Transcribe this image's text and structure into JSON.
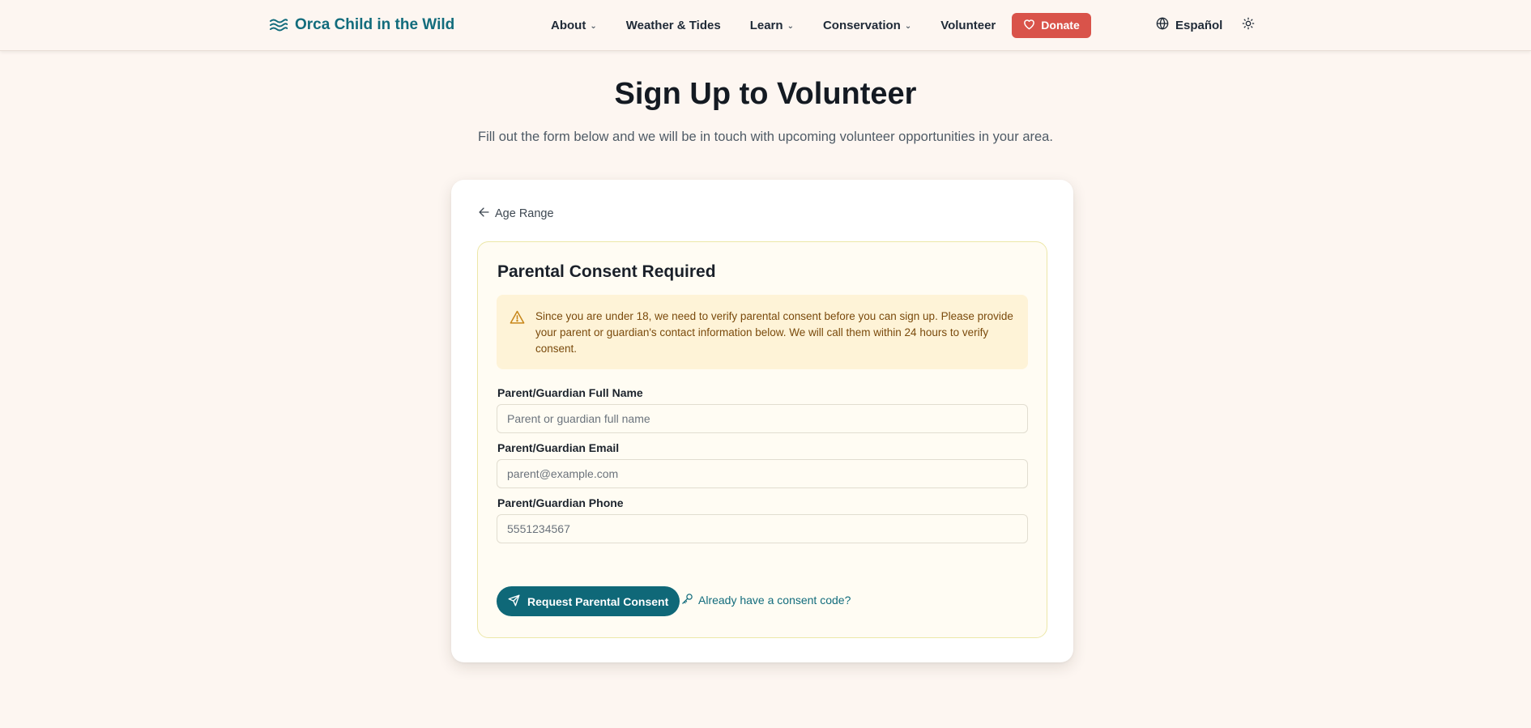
{
  "header": {
    "brand": "Orca Child in the Wild",
    "nav": [
      {
        "label": "About",
        "has_dropdown": true
      },
      {
        "label": "Weather & Tides",
        "has_dropdown": false
      },
      {
        "label": "Learn",
        "has_dropdown": true
      },
      {
        "label": "Conservation",
        "has_dropdown": true
      },
      {
        "label": "Volunteer",
        "has_dropdown": false
      }
    ],
    "donate_label": "Donate",
    "language_label": "Español",
    "icons": {
      "brand": "waves-icon",
      "donate": "heart-icon",
      "language": "globe-icon",
      "theme": "sun-icon"
    }
  },
  "page": {
    "title": "Sign Up to Volunteer",
    "subtitle": "Fill out the form below and we will be in touch with upcoming volunteer opportunities in your area."
  },
  "form": {
    "back_label": "Age Range",
    "consent_title": "Parental Consent Required",
    "alert_text": "Since you are under 18, we need to verify parental consent before you can sign up. Please provide your parent or guardian's contact information below. We will call them within 24 hours to verify consent.",
    "fields": [
      {
        "label": "Parent/Guardian Full Name",
        "placeholder": "Parent or guardian full name",
        "value": ""
      },
      {
        "label": "Parent/Guardian Email",
        "placeholder": "parent@example.com",
        "value": ""
      },
      {
        "label": "Parent/Guardian Phone",
        "placeholder": "5551234567",
        "value": ""
      }
    ],
    "submit_label": "Request Parental Consent",
    "code_link_label": "Already have a consent code?"
  },
  "colors": {
    "brand": "#126c7c",
    "donate": "#d9534a",
    "primary_button": "#0f6878",
    "alert_bg": "#fef3d7",
    "alert_text": "#7a4a0c",
    "background": "#fdf6f1"
  }
}
